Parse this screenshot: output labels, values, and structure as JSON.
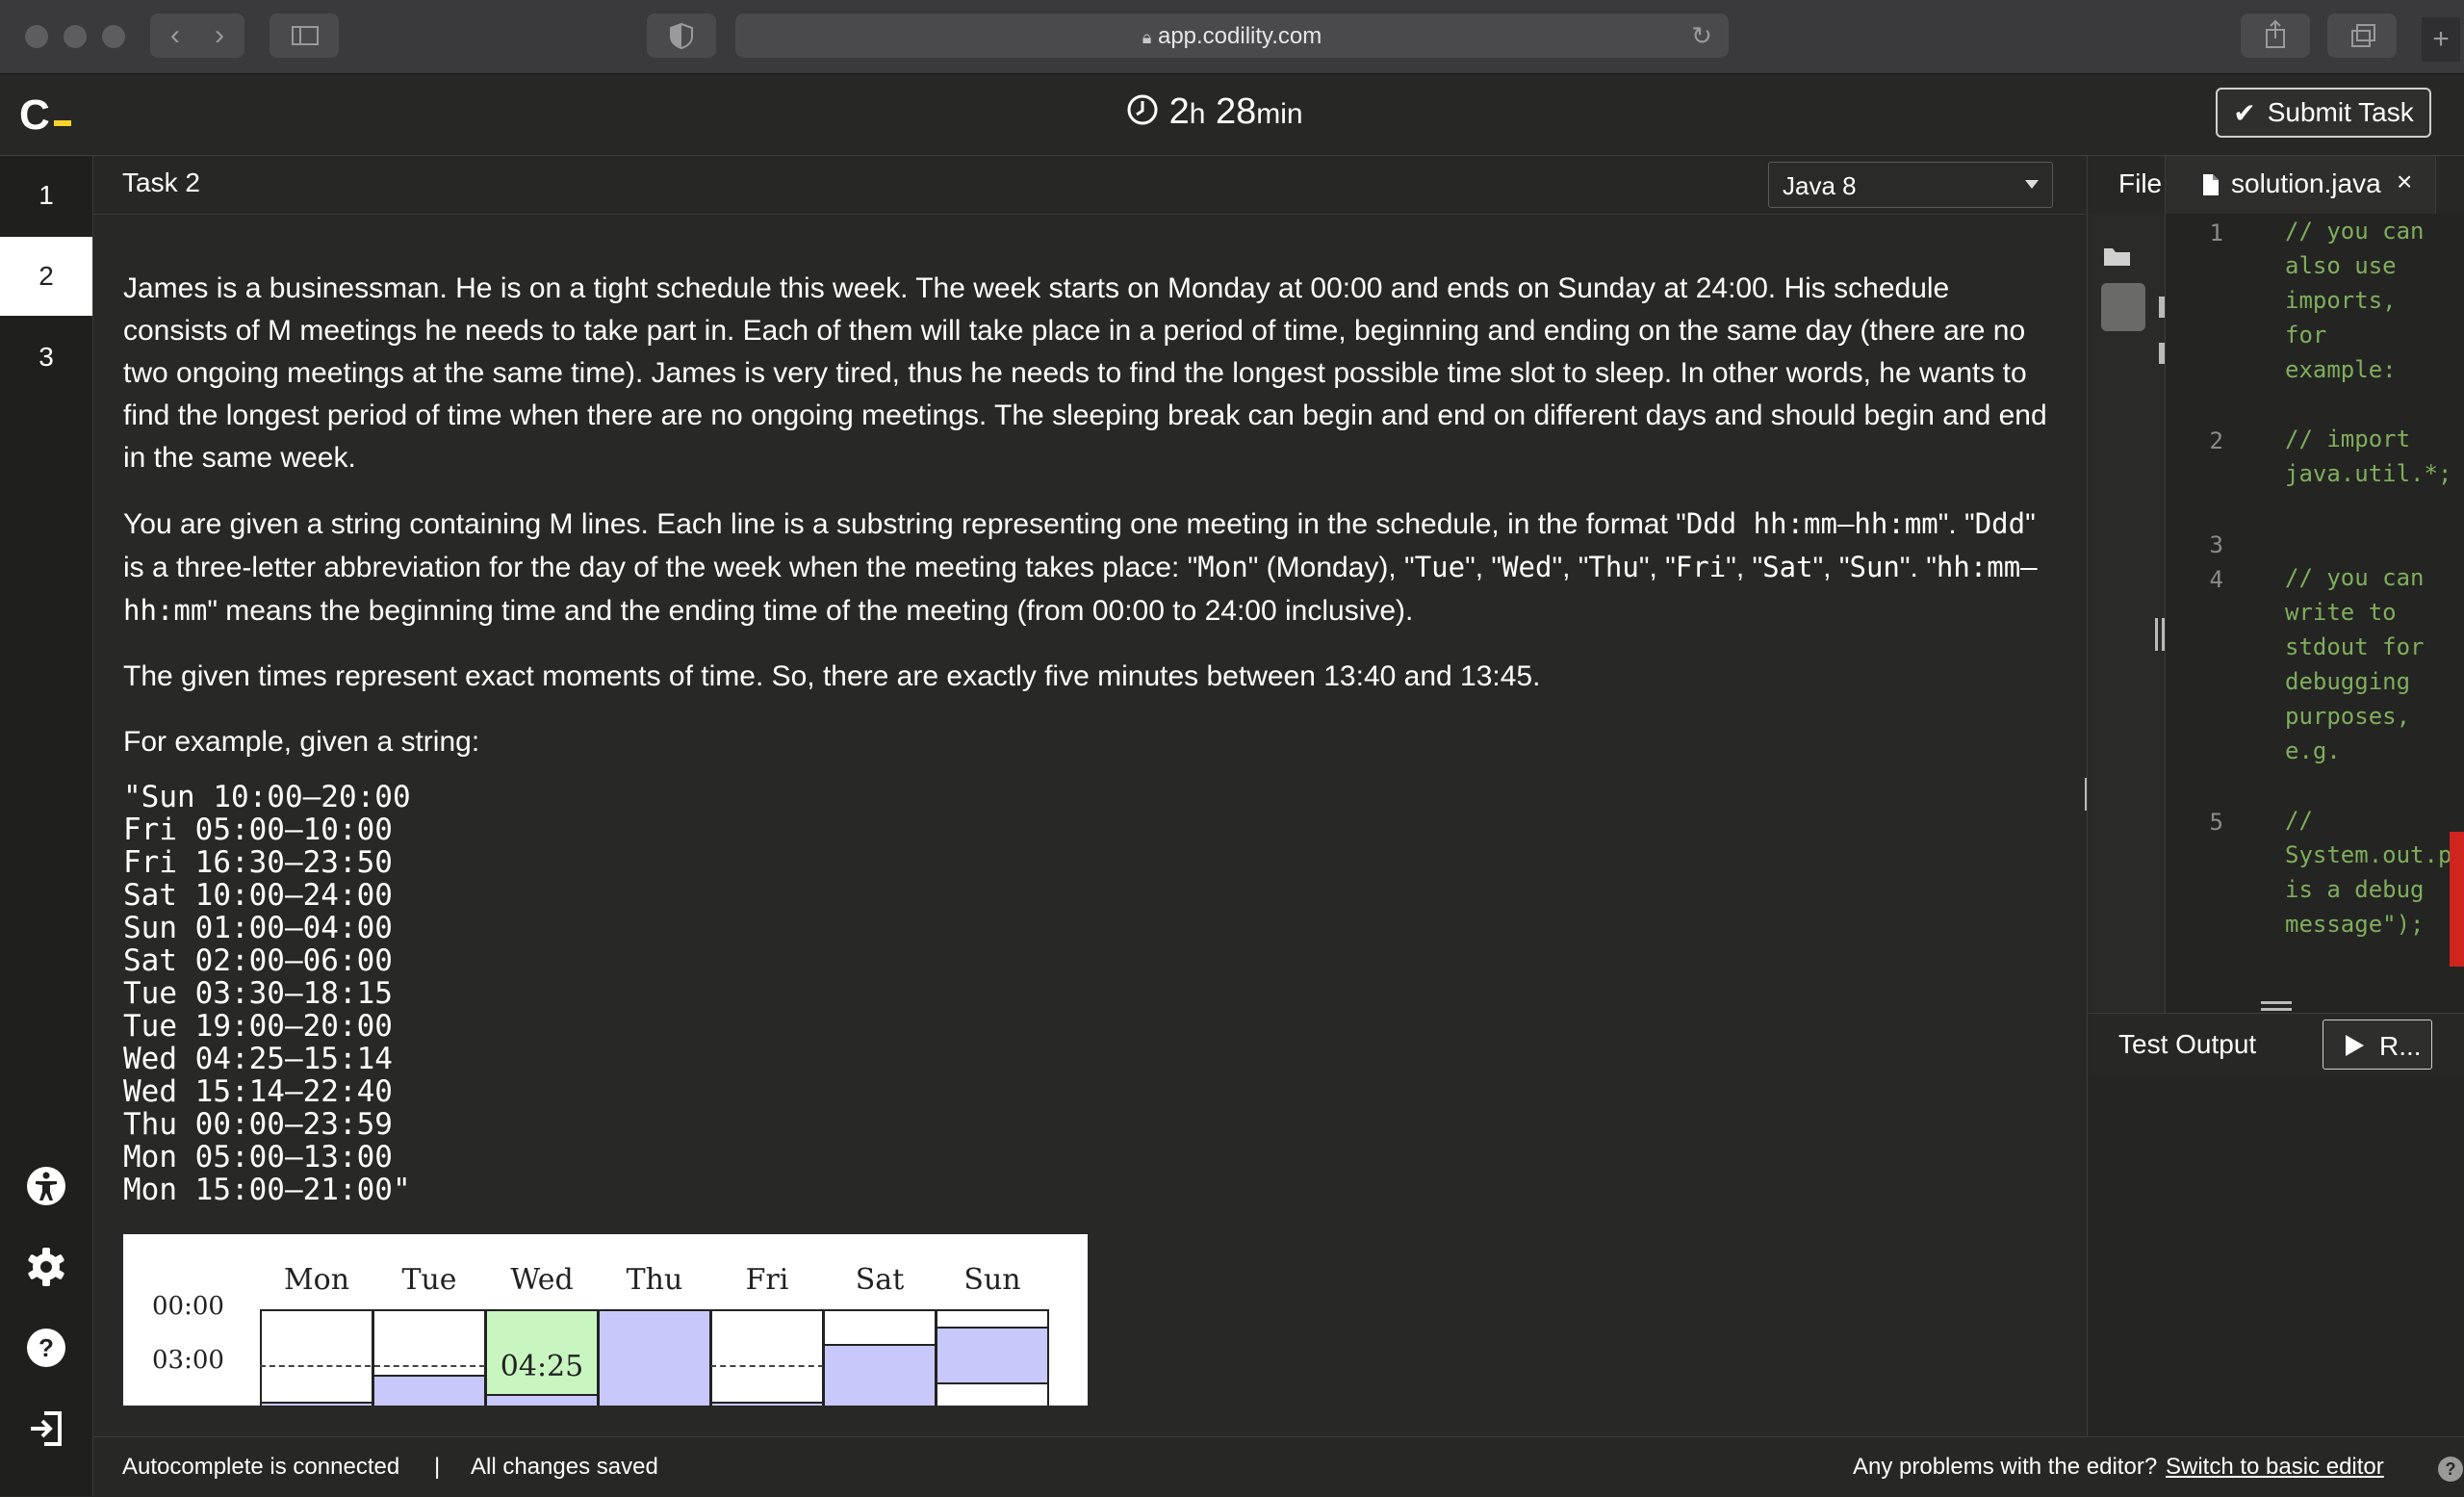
{
  "browser": {
    "url": "app.codility.com"
  },
  "header": {
    "timer_hours": "2",
    "timer_h_unit": "h",
    "timer_minutes": "28",
    "timer_min_unit": "min",
    "submit_label": "Submit Task"
  },
  "tasks": {
    "items": [
      "1",
      "2",
      "3"
    ],
    "active": "2"
  },
  "task": {
    "title": "Task 2",
    "language": "Java 8",
    "paragraphs": {
      "p1": "James is a businessman. He is on a tight schedule this week. The week starts on Monday at 00:00 and ends on Sunday at 24:00. His schedule consists of M meetings he needs to take part in. Each of them will take place in a period of time, beginning and ending on the same day (there are no two ongoing meetings at the same time). James is very tired, thus he needs to find the longest possible time slot to sleep. In other words, he wants to find the longest period of time when there are no ongoing meetings. The sleeping break can begin and end on different days and should begin and end in the same week.",
      "p2_a": "You are given a string containing M lines. Each line is a substring representing one meeting in the schedule, in the format \"",
      "p2_code1": "Ddd hh:mm–hh:mm",
      "p2_b": "\". \"",
      "p2_code2": "Ddd",
      "p2_c": "\" is a three-letter abbreviation for the day of the week when the meeting takes place: \"",
      "p2_code3": "Mon",
      "p2_d": "\" (Monday), \"",
      "p2_code4": "Tue",
      "p2_e": "\", \"",
      "p2_code5": "Wed",
      "p2_f": "\", \"",
      "p2_code6": "Thu",
      "p2_g": "\", \"",
      "p2_code7": "Fri",
      "p2_h": "\", \"",
      "p2_code8": "Sat",
      "p2_i": "\", \"",
      "p2_code9": "Sun",
      "p2_j": "\". \"",
      "p2_code10": "hh:mm–hh:mm",
      "p2_k": "\" means the beginning time and the ending time of the meeting (from 00:00 to 24:00 inclusive).",
      "p3": "The given times represent exact moments of time. So, there are exactly five minutes between 13:40 and 13:45.",
      "p4": "For example, given a string:"
    },
    "example": "\"Sun 10:00–20:00\nFri 05:00–10:00\nFri 16:30–23:50\nSat 10:00–24:00\nSun 01:00–04:00\nSat 02:00–06:00\nTue 03:30–18:15\nTue 19:00–20:00\nWed 04:25–15:14\nWed 15:14–22:40\nThu 00:00–23:59\nMon 05:00–13:00\nMon 15:00–21:00\"",
    "schedule_figure": {
      "days": [
        "Mon",
        "Tue",
        "Wed",
        "Thu",
        "Fri",
        "Sat",
        "Sun"
      ],
      "times": [
        "00:00",
        "03:00"
      ],
      "highlight_label": "04:25"
    }
  },
  "editor": {
    "files_label": "Files",
    "file_name": "solution.java",
    "close_symbol": "×",
    "lines": [
      {
        "n": "1",
        "code": "// you can also use imports, for example:"
      },
      {
        "n": "2",
        "code": "// import java.util.*;"
      },
      {
        "n": "3",
        "code": ""
      },
      {
        "n": "4",
        "code": "// you can write to stdout for debugging purposes, e.g."
      },
      {
        "n": "5",
        "code": "// System.out.println(\"this is a debug message\");"
      }
    ]
  },
  "output": {
    "title": "Test Output",
    "run_label": "R..."
  },
  "status": {
    "autocomplete": "Autocomplete is connected",
    "separator": "|",
    "saved": "All changes saved",
    "problems": "Any problems with the editor?",
    "switch_link": "Switch to basic editor",
    "help_symbol": "?"
  },
  "colors": {
    "background": "#282826",
    "meeting_fill": "#c8c8fb",
    "gap_fill": "#c9f6c0",
    "scroll_marker": "#d0241f",
    "logo_accent": "#f8d32a"
  }
}
